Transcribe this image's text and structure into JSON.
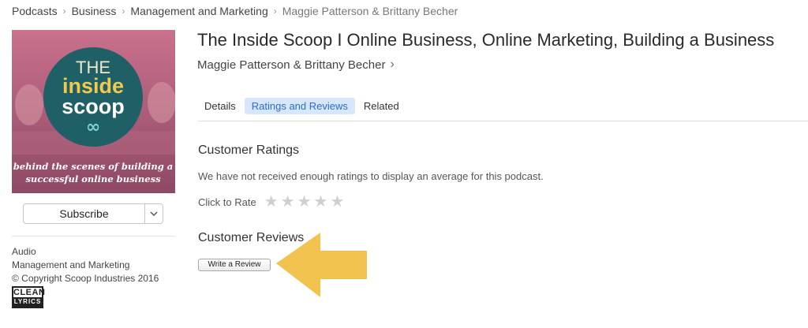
{
  "breadcrumb": {
    "items": [
      "Podcasts",
      "Business",
      "Management and Marketing",
      "Maggie Patterson & Brittany Becher"
    ]
  },
  "artwork": {
    "line1": "THE",
    "line2": "inside",
    "line3": "scoop",
    "symbol": "∞",
    "tagline1": "behind the scenes of building a",
    "tagline2": "successful online business"
  },
  "subscribe": {
    "label": "Subscribe"
  },
  "meta": {
    "type": "Audio",
    "category": "Management and Marketing",
    "copyright": "© Copyright Scoop Industries 2016"
  },
  "badge": {
    "top": "CLEAN",
    "bottom": "LYRICS"
  },
  "podcast": {
    "title": "The Inside Scoop I Online Business, Online Marketing, Building a Business",
    "author": "Maggie Patterson & Brittany Becher"
  },
  "tabs": [
    "Details",
    "Ratings and Reviews",
    "Related"
  ],
  "active_tab": "Ratings and Reviews",
  "ratings": {
    "heading": "Customer Ratings",
    "note": "We have not received enough ratings to display an average for this podcast.",
    "click_to_rate": "Click to Rate",
    "stars_filled": 0,
    "stars_total": 5
  },
  "reviews": {
    "heading": "Customer Reviews",
    "write_button": "Write a Review"
  },
  "colors": {
    "active_tab_bg": "#d6e7fb",
    "active_tab_text": "#2f6cc8",
    "arrow": "#f2c24f",
    "artwork_circle": "#1f5f66"
  }
}
